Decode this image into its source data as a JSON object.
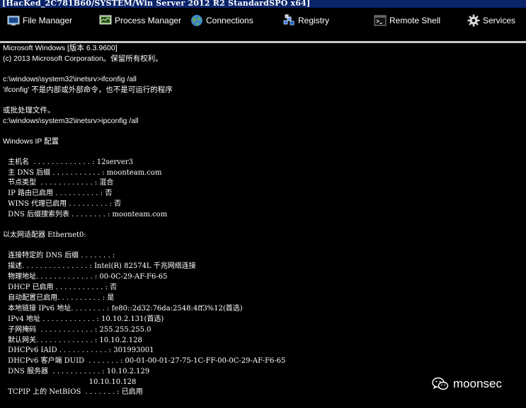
{
  "window": {
    "title": "[HacKed_2C781B60/SYSTEM/Win Server 2012 R2 StandardSPO x64]"
  },
  "toolbar": {
    "items": [
      {
        "label": "File Manager",
        "icon": "file-manager-icon"
      },
      {
        "label": "Process Manager",
        "icon": "process-manager-icon"
      },
      {
        "label": "Connections",
        "icon": "globe-icon"
      },
      {
        "label": "Registry",
        "icon": "registry-icon"
      },
      {
        "label": "Remote Shell",
        "icon": "terminal-icon"
      },
      {
        "label": "Services",
        "icon": "gear-icon"
      }
    ]
  },
  "console": {
    "lines": [
      "Microsoft Windows [版本 6.3.9600]",
      "(c) 2013 Microsoft Corporation。保留所有权利。",
      "c:\\windows\\system32\\inetsrv>ifconfig /all",
      "'ifconfig' 不是内部或外部命令，也不是可运行的程序",
      "或批处理文件。",
      "c:\\windows\\system32\\inetsrv>ipconfig /all",
      "Windows IP 配置",
      " 主机名  . . . . . . . . . . . . . : 12server3",
      " 主 DNS 后缀 . . . . . . . . . . . : moonteam.com",
      " 节点类型  . . . . . . . . . . . . : 混合",
      " IP 路由已启用 . . . . . . . . . . : 否",
      " WINS 代理已启用 . . . . . . . . . : 否",
      " DNS 后缀搜索列表 . . . . . . . . : moonteam.com",
      "以太网适配器 Ethernet0:",
      " 连接特定的 DNS 后缀 . . . . . . . :",
      " 描述. . . . . . . . . . . . . . . : Intel(R) 82574L 千兆网络连接",
      " 物理地址. . . . . . . . . . . . . : 00-0C-29-AF-F6-65",
      " DHCP 已启用 . . . . . . . . . . . : 否",
      " 自动配置已启用. . . . . . . . . . : 是",
      " 本地链接 IPv6 地址. . . . . . . . : fe80::2d32:76da:2548:4ff3%12(首选)",
      " IPv4 地址 . . . . . . . . . . . . : 10.10.2.131(首选)",
      " 子网掩码  . . . . . . . . . . . . : 255.255.255.0",
      " 默认网关. . . . . . . . . . . . . : 10.10.2.128",
      " DHCPv6 IAID . . . . . . . . . . . : 301993001",
      " DHCPv6 客户端 DUID  . . . . . . . : 00-01-00-01-27-75-1C-FF-00-0C-29-AF-F6-65",
      " DNS 服务器  . . . . . . . . . . . : 10.10.2.129",
      "                                     10.10.10.128",
      " TCPIP 上的 NetBIOS  . . . . . . . : 已启用"
    ]
  },
  "watermark": {
    "text": "moonsec",
    "icon": "wechat-icon"
  }
}
